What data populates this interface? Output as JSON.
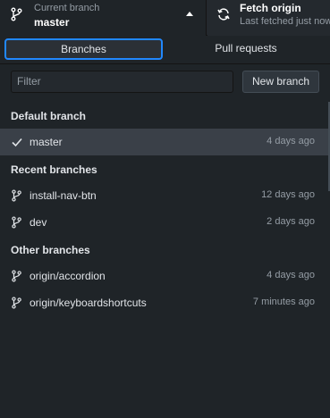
{
  "toolbar": {
    "current_branch": {
      "caption": "Current branch",
      "value": "master"
    },
    "fetch": {
      "title": "Fetch origin",
      "subtitle": "Last fetched just now"
    }
  },
  "tabs": [
    {
      "label": "Branches"
    },
    {
      "label": "Pull requests"
    }
  ],
  "filter": {
    "placeholder": "Filter"
  },
  "new_branch_label": "New branch",
  "sections": {
    "default": {
      "header": "Default branch",
      "items": [
        {
          "name": "master",
          "time": "4 days ago"
        }
      ]
    },
    "recent": {
      "header": "Recent branches",
      "items": [
        {
          "name": "install-nav-btn",
          "time": "12 days ago"
        },
        {
          "name": "dev",
          "time": "2 days ago"
        }
      ]
    },
    "other": {
      "header": "Other branches",
      "items": [
        {
          "name": "origin/accordion",
          "time": "4 days ago"
        },
        {
          "name": "origin/keyboardshortcuts",
          "time": "7 minutes ago"
        }
      ]
    }
  }
}
